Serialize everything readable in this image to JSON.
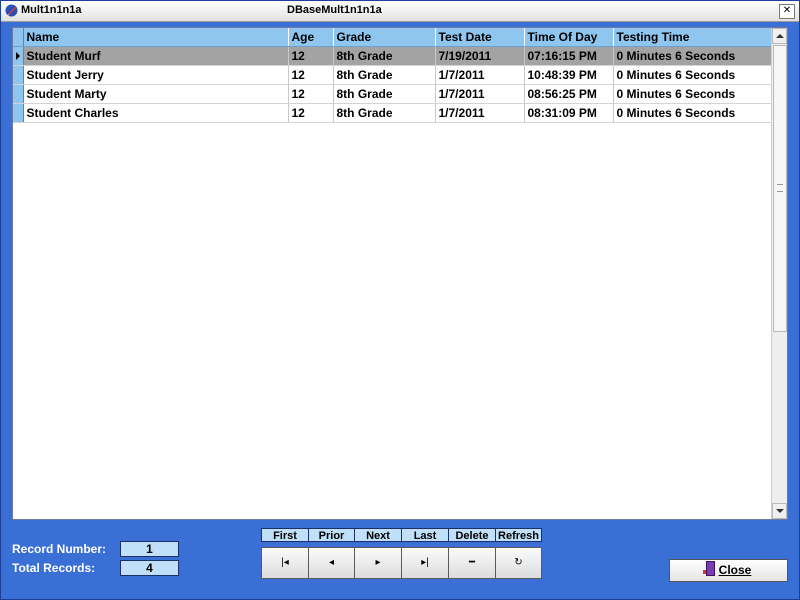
{
  "window": {
    "title_left": "Mult1n1n1a",
    "title_center": "DBaseMult1n1n1a",
    "close_glyph": "✕"
  },
  "grid": {
    "columns": [
      "Name",
      "Age",
      "Grade",
      "Test Date",
      "Time Of Day",
      "Testing Time"
    ],
    "rows": [
      {
        "name": "Student Murf",
        "age": "12",
        "grade": "8th Grade",
        "test_date": "7/19/2011",
        "time_of_day": "07:16:15 PM",
        "testing_time": "0 Minutes  6 Seconds"
      },
      {
        "name": "Student Jerry",
        "age": "12",
        "grade": "8th Grade",
        "test_date": "1/7/2011",
        "time_of_day": "10:48:39 PM",
        "testing_time": "0 Minutes  6 Seconds"
      },
      {
        "name": "Student Marty",
        "age": "12",
        "grade": "8th Grade",
        "test_date": "1/7/2011",
        "time_of_day": "08:56:25 PM",
        "testing_time": "0 Minutes  6 Seconds"
      },
      {
        "name": "Student Charles",
        "age": "12",
        "grade": "8th Grade",
        "test_date": "1/7/2011",
        "time_of_day": "08:31:09 PM",
        "testing_time": "0 Minutes  6 Seconds"
      }
    ],
    "selected_row": 0
  },
  "records": {
    "record_number_label": "Record Number:",
    "record_number": "1",
    "total_records_label": "Total Records:",
    "total_records": "4"
  },
  "navigator": {
    "labels": [
      "First",
      "Prior",
      "Next",
      "Last",
      "Delete",
      "Refresh"
    ],
    "glyphs": [
      "|◂",
      "◂",
      "▸",
      "▸|",
      "━",
      "↻"
    ],
    "icons": [
      "first-record-icon",
      "prior-record-icon",
      "next-record-icon",
      "last-record-icon",
      "delete-record-icon",
      "refresh-icon"
    ]
  },
  "close_button": {
    "label": "Close",
    "icon": "door-exit-icon"
  }
}
